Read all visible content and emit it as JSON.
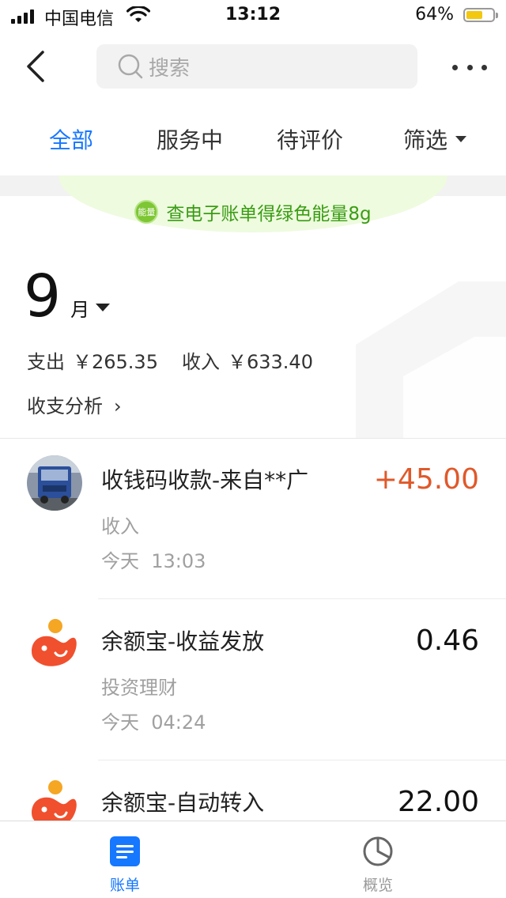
{
  "status_bar": {
    "carrier": "中国电信",
    "time": "13:12",
    "battery_percent": "64%",
    "battery_level": 0.64
  },
  "nav": {
    "search_placeholder": "搜索"
  },
  "tabs": [
    {
      "label": "全部",
      "active": true
    },
    {
      "label": "服务中",
      "active": false
    },
    {
      "label": "待评价",
      "active": false
    },
    {
      "label": "筛选",
      "active": false
    }
  ],
  "banner": {
    "badge": "能量",
    "text": "查电子账单得绿色能量8g"
  },
  "summary": {
    "month_number": "9",
    "month_unit": "月",
    "expense_label": "支出",
    "expense_value": "￥265.35",
    "income_label": "收入",
    "income_value": "￥633.40",
    "analysis_label": "收支分析"
  },
  "transactions": [
    {
      "title": "收钱码收款-来自**广",
      "category": "收入",
      "date": "今天",
      "time": "13:03",
      "amount": "+45.00",
      "avatar": "truck-photo"
    },
    {
      "title": "余额宝-收益发放",
      "category": "投资理财",
      "date": "今天",
      "time": "04:24",
      "amount": "0.46",
      "avatar": "yuebao-logo"
    },
    {
      "title": "余额宝-自动转入",
      "category": "",
      "date": "",
      "time": "",
      "amount": "22.00",
      "avatar": "yuebao-logo"
    }
  ],
  "bottom_tabs": [
    {
      "label": "账单",
      "icon": "bill-icon",
      "active": true
    },
    {
      "label": "概览",
      "icon": "pie-chart-icon",
      "active": false
    }
  ],
  "colors": {
    "accent_blue": "#1677ff",
    "income_orange": "#e0592a",
    "energy_green": "#3a9c14"
  }
}
